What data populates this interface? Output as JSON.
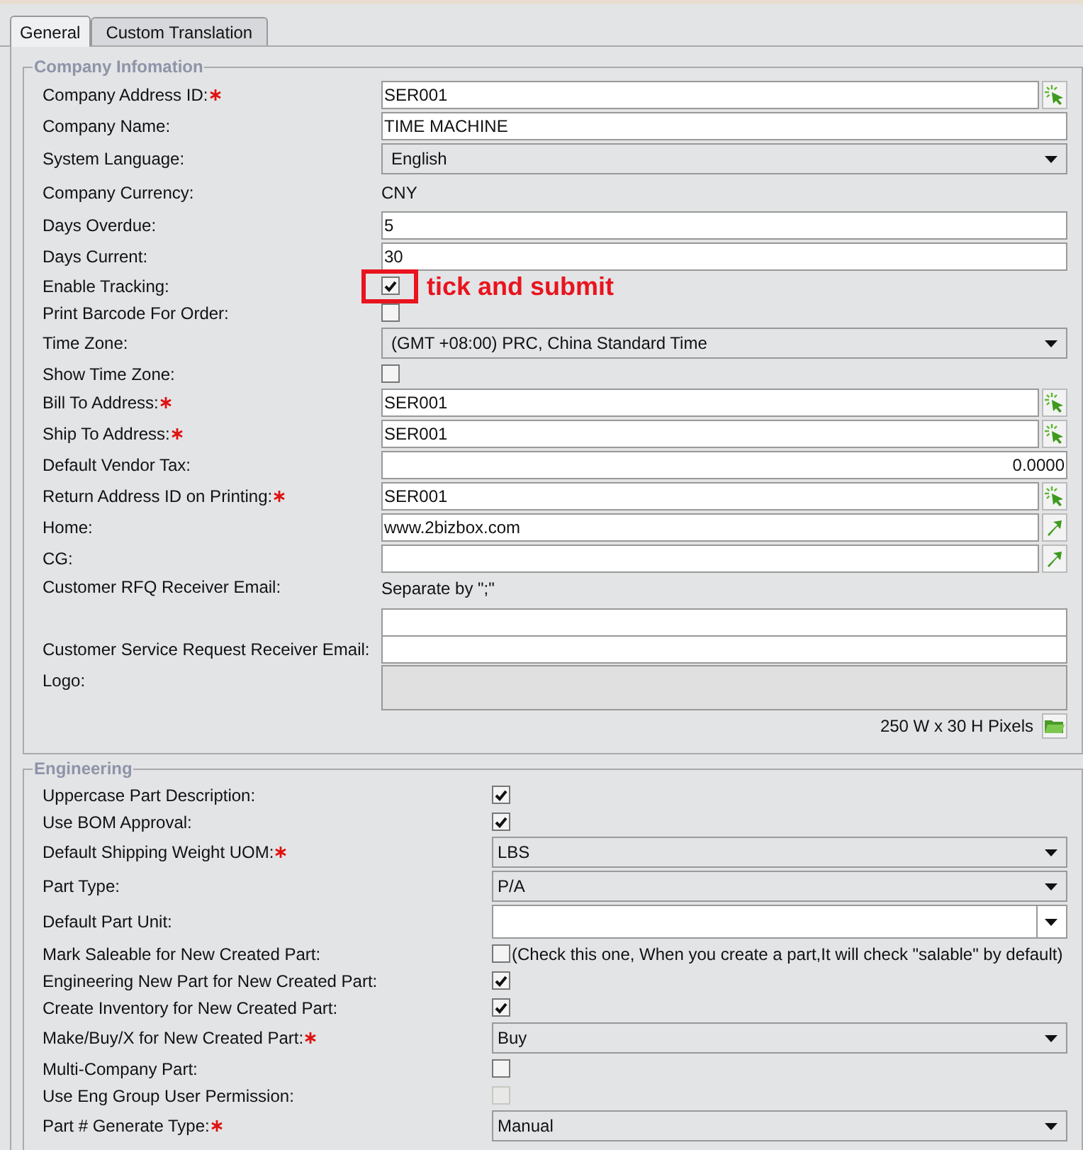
{
  "tabs": [
    {
      "label": "General",
      "selected": true
    },
    {
      "label": "Custom Translation",
      "selected": false
    }
  ],
  "sections": [
    {
      "title": "Company Infomation",
      "rows": [
        {
          "kind": "picker_text",
          "label": "Company Address ID:",
          "required": true,
          "value": "SER001"
        },
        {
          "kind": "text",
          "label": "Company Name:",
          "required": false,
          "value": "TIME MACHINE"
        },
        {
          "kind": "select",
          "label": "System Language:",
          "required": false,
          "value": "English"
        },
        {
          "kind": "static",
          "label": "Company Currency:",
          "required": false,
          "value": "CNY"
        },
        {
          "kind": "text",
          "label": "Days Overdue:",
          "required": false,
          "value": "5"
        },
        {
          "kind": "text",
          "label": "Days Current:",
          "required": false,
          "value": "30"
        },
        {
          "kind": "checkbox",
          "label": "Enable Tracking:",
          "required": false,
          "checked": true,
          "annotation": "tick and submit"
        },
        {
          "kind": "checkbox",
          "label": "Print Barcode For Order:",
          "required": false,
          "checked": false
        },
        {
          "kind": "select",
          "label": "Time Zone:",
          "required": false,
          "value": "(GMT +08:00) PRC, China Standard Time"
        },
        {
          "kind": "checkbox",
          "label": "Show Time Zone:",
          "required": false,
          "checked": false
        },
        {
          "kind": "picker_text",
          "label": "Bill To Address:",
          "required": true,
          "value": "SER001"
        },
        {
          "kind": "picker_text",
          "label": "Ship To Address:",
          "required": true,
          "value": "SER001"
        },
        {
          "kind": "number",
          "label": "Default Vendor Tax:",
          "required": false,
          "value": "0.0000"
        },
        {
          "kind": "picker_text",
          "label": "Return Address ID on Printing:",
          "required": true,
          "value": "SER001"
        },
        {
          "kind": "link_text",
          "label": "Home:",
          "required": false,
          "value": "www.2bizbox.com"
        },
        {
          "kind": "link_text",
          "label": "CG:",
          "required": false,
          "value": ""
        },
        {
          "kind": "noted_text",
          "label": "Customer RFQ Receiver Email:",
          "required": false,
          "note": "Separate by \";\"",
          "value": ""
        },
        {
          "kind": "text",
          "label": "Customer Service Request Receiver Email:",
          "required": false,
          "value": ""
        },
        {
          "kind": "logo",
          "label": "Logo:",
          "required": false,
          "size_note": "250 W x 30 H Pixels"
        }
      ]
    },
    {
      "title": "Engineering",
      "rows": [
        {
          "kind": "checkbox",
          "label": "Uppercase Part Description:",
          "required": false,
          "checked": true
        },
        {
          "kind": "checkbox",
          "label": "Use BOM Approval:",
          "required": false,
          "checked": true
        },
        {
          "kind": "select",
          "label": "Default Shipping Weight UOM:",
          "required": true,
          "value": "LBS"
        },
        {
          "kind": "select",
          "label": "Part Type:",
          "required": false,
          "value": "P/A"
        },
        {
          "kind": "combo",
          "label": "Default Part Unit:",
          "required": false,
          "value": ""
        },
        {
          "kind": "checkbox",
          "label": "Mark Saleable for New Created Part:",
          "required": false,
          "checked": false,
          "note": "(Check this one, When you create a part,It will check \"salable\" by default)"
        },
        {
          "kind": "checkbox",
          "label": "Engineering New Part for New Created Part:",
          "required": false,
          "checked": true
        },
        {
          "kind": "checkbox",
          "label": "Create Inventory for New Created Part:",
          "required": false,
          "checked": true
        },
        {
          "kind": "select",
          "label": "Make/Buy/X for New Created Part:",
          "required": true,
          "value": "Buy"
        },
        {
          "kind": "checkbox",
          "label": "Multi-Company Part:",
          "required": false,
          "checked": false
        },
        {
          "kind": "checkbox",
          "label": "Use Eng Group User Permission:",
          "required": false,
          "checked": false,
          "disabled": true
        },
        {
          "kind": "select",
          "label": "Part # Generate Type:",
          "required": true,
          "value": "Manual"
        }
      ]
    }
  ]
}
